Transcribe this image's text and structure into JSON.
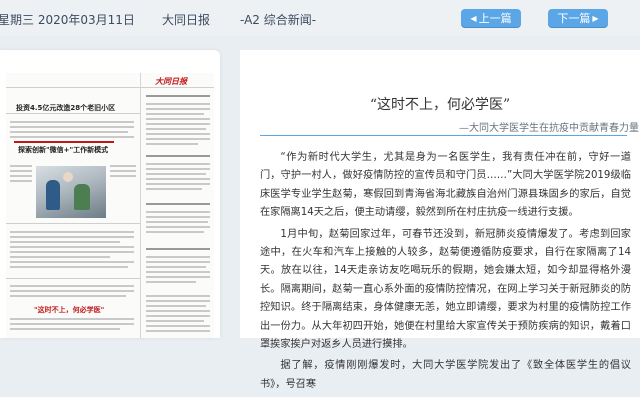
{
  "header": {
    "date": "星期三 2020年03月11日",
    "newspaper": "大同日报",
    "section": "-A2 综合新闻-",
    "prev_label": "上一篇",
    "next_label": "下一篇"
  },
  "preview": {
    "logo_text": "大同日报",
    "headlines": [
      "投资4.5亿元改造28个老旧小区",
      "探索创新\"微信+\"工作新模式",
      "\"这时不上，何必学医\""
    ]
  },
  "article": {
    "title": "“这时不上，何必学医”",
    "subtitle": "—大同大学医学生在抗疫中贡献青春力量",
    "paragraphs": [
      "“作为新时代大学生，尤其是身为一名医学生，我有责任冲在前，守好一道门，守护一村人，做好疫情防控的宣传员和守门员……”大同大学医学院2019级临床医学专业学生赵菊，寒假回到青海省海北藏族自治州门源县珠固乡的家后，自觉在家隔离14天之后，便主动请缨，毅然到所在村庄抗疫一线进行支援。",
      "1月中旬，赵菊回家过年，可春节还没到，新冠肺炎疫情爆发了。考虑到回家途中，在火车和汽车上接触的人较多，赵菊便遵循防疫要求，自行在家隔离了14天。放在以往，14天走亲访友吃喝玩乐的假期，她会嫌太短，如今却显得格外漫长。隔离期间，赵菊一直心系外面的疫情防控情况，在网上学习关于新冠肺炎的防控知识。终于隔离结束，身体健康无恙，她立即请缨，要求为村里的疫情防控工作出一份力。从大年初四开始，她便在村里给大家宣传关于预防疾病的知识，戴着口罩挨家挨户对返乡人员进行摸排。",
      "据了解，疫情刚刚爆发时，大同大学医学院发出了《致全体医学生的倡议书》，号召寒"
    ]
  },
  "colors": {
    "accent": "#5aa6e6",
    "background": "#e9eef3",
    "brand_red": "#c01818"
  }
}
